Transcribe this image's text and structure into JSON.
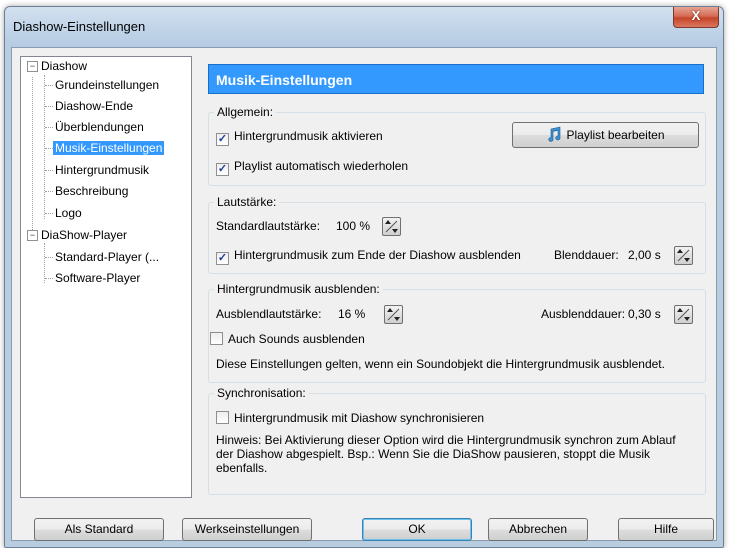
{
  "window": {
    "title": "Diashow-Einstellungen",
    "close_glyph": "X"
  },
  "tree": {
    "root1": "Diashow",
    "root1_items": [
      "Grundeinstellungen",
      "Diashow-Ende",
      "Überblendungen",
      "Musik-Einstellungen",
      "Hintergrundmusik",
      "Beschreibung",
      "Logo"
    ],
    "root2": "DiaShow-Player",
    "root2_items": [
      "Standard-Player (...",
      "Software-Player"
    ],
    "expander_glyph": "−",
    "selected_index": 3
  },
  "panel": {
    "title": "Musik-Einstellungen",
    "allgemein": {
      "label": "Allgemein:",
      "bg_music_enable": "Hintergrundmusik aktivieren",
      "bg_music_checked": true,
      "playlist_repeat": "Playlist automatisch wiederholen",
      "playlist_repeat_checked": true,
      "playlist_button": "Playlist bearbeiten"
    },
    "lautstaerke": {
      "label": "Lautstärke:",
      "standard_label": "Standardlautstärke:",
      "standard_value": "100 %",
      "fade_end": "Hintergrundmusik zum Ende der Diashow ausblenden",
      "fade_end_checked": true,
      "blend_label": "Blenddauer:",
      "blend_value": "2,00 s"
    },
    "ausblenden": {
      "label": "Hintergrundmusik ausblenden:",
      "vol_label": "Ausblendlautstärke:",
      "vol_value": "16 %",
      "dur_label": "Ausblenddauer:",
      "dur_value": "0,30 s",
      "sounds": "Auch Sounds ausblenden",
      "sounds_checked": false,
      "info": "Diese Einstellungen gelten, wenn ein Soundobjekt die Hintergrundmusik ausblendet."
    },
    "sync": {
      "label": "Synchronisation:",
      "sync_cb": "Hintergrundmusik mit Diashow synchronisieren",
      "sync_checked": false,
      "hint_line1": "Hinweis: Bei Aktivierung dieser Option wird die Hintergrundmusik synchron zum Ablauf",
      "hint_line2": "der Diashow abgespielt. Bsp.: Wenn Sie die DiaShow pausieren, stoppt die Musik",
      "hint_line3": "ebenfalls."
    }
  },
  "buttons": {
    "als_standard": "Als Standard",
    "werkseinstellungen": "Werkseinstellungen",
    "ok": "OK",
    "abbrechen": "Abbrechen",
    "hilfe": "Hilfe"
  },
  "check_glyph": "✓",
  "icons": {
    "playlist": "music-note-icon",
    "spinner": "spinner-icon"
  }
}
